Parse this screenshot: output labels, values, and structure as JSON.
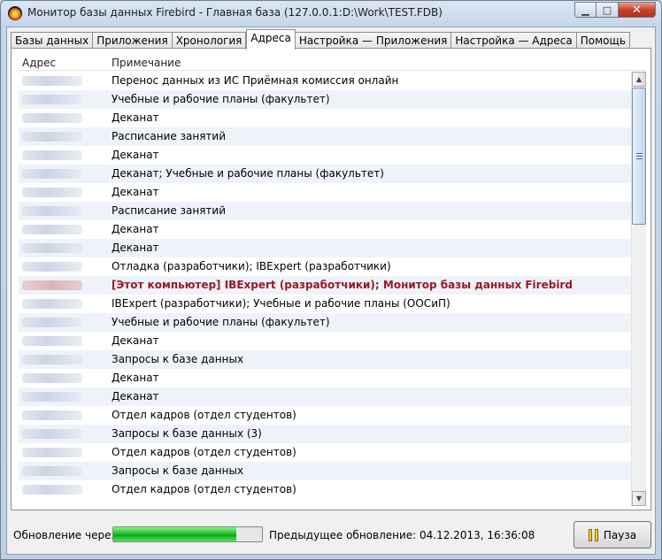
{
  "window": {
    "title": "Монитор базы данных Firebird - Главная база (127.0.0.1:D:\\Work\\TEST.FDB)",
    "minimize_icon": "minimize-icon",
    "maximize_icon": "maximize-icon",
    "close_icon": "close-icon"
  },
  "tabs": [
    {
      "label": "Базы данных"
    },
    {
      "label": "Приложения"
    },
    {
      "label": "Хронология"
    },
    {
      "label": "Адреса",
      "active": true
    },
    {
      "label": "Настройка — Приложения"
    },
    {
      "label": "Настройка — Адреса"
    },
    {
      "label": "Помощь"
    }
  ],
  "table": {
    "columns": [
      "Адрес",
      "Примечание"
    ],
    "rows": [
      {
        "note": "Перенос данных из ИС Приёмная комиссия онлайн"
      },
      {
        "note": "Учебные и рабочие планы (факультет)"
      },
      {
        "note": "Деканат"
      },
      {
        "note": "Расписание занятий"
      },
      {
        "note": "Деканат"
      },
      {
        "note": "Деканат; Учебные и рабочие планы (факультет)"
      },
      {
        "note": "Деканат"
      },
      {
        "note": "Расписание занятий"
      },
      {
        "note": "Деканат"
      },
      {
        "note": "Деканат"
      },
      {
        "note": "Отладка (разработчики); IBExpert (разработчики)"
      },
      {
        "note": "[Этот компьютер] IBExpert (разработчики); Монитор базы данных Firebird",
        "highlight": true
      },
      {
        "note": "IBExpert (разработчики); Учебные и рабочие планы (ООСиП)"
      },
      {
        "note": "Учебные и рабочие планы (факультет)"
      },
      {
        "note": "Деканат"
      },
      {
        "note": "Запросы к базе данных"
      },
      {
        "note": "Деканат"
      },
      {
        "note": "Деканат"
      },
      {
        "note": "Отдел кадров (отдел студентов)"
      },
      {
        "note": "Запросы к базе данных (3)"
      },
      {
        "note": "Отдел кадров (отдел студентов)"
      },
      {
        "note": "Запросы к базе данных"
      },
      {
        "note": "Отдел кадров (отдел студентов)"
      }
    ]
  },
  "status": {
    "update_label": "Обновление через",
    "progress": 0.83,
    "previous_update": "Предыдущее обновление: 04.12.2013, 16:36:08",
    "pause_label": "Пауза"
  },
  "colors": {
    "highlight_text": "#9a1a24",
    "progress_green": "#1fc22a",
    "row_alt": "#eef3fa"
  }
}
